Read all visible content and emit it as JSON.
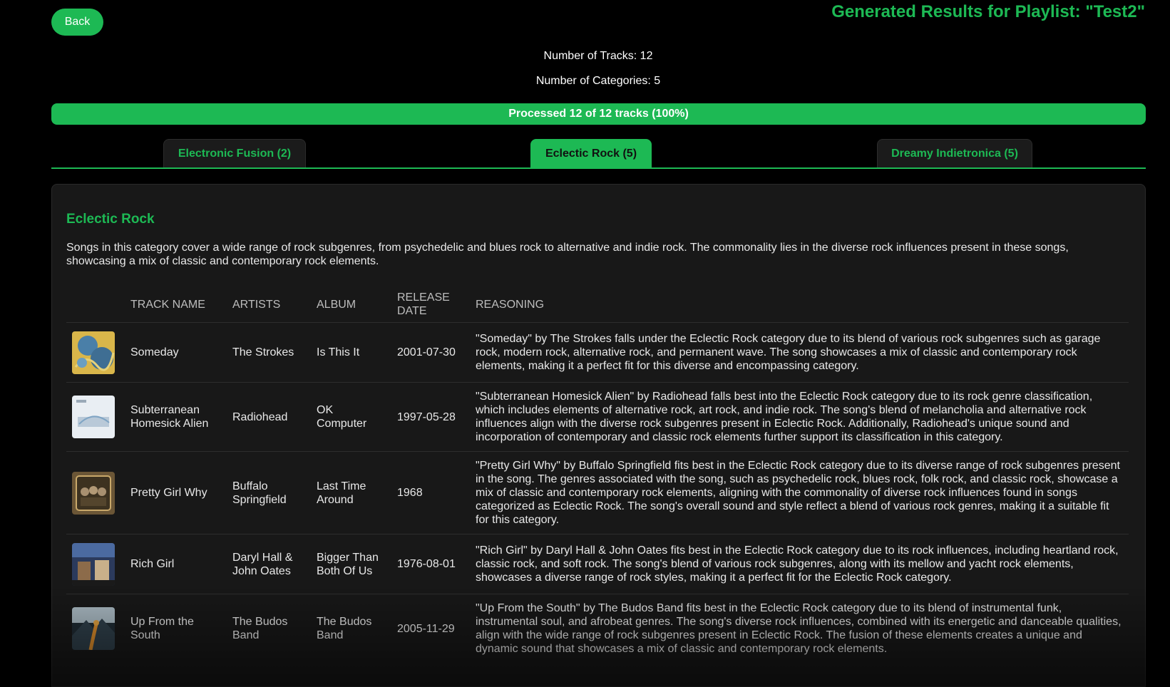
{
  "header": {
    "back_label": "Back",
    "title": "Generated Results for Playlist: \"Test2\""
  },
  "stats": {
    "tracks": "Number of Tracks: 12",
    "categories": "Number of Categories: 5"
  },
  "progress": {
    "label": "Processed 12 of 12 tracks (100%)",
    "fraction": 1.0,
    "color": "#1db954"
  },
  "tabs": [
    {
      "label": "Electronic Fusion (2)",
      "active": false
    },
    {
      "label": "Eclectic Rock (5)",
      "active": true
    },
    {
      "label": "Dreamy Indietronica (5)",
      "active": false
    }
  ],
  "category": {
    "title": "Eclectic Rock",
    "description": "Songs in this category cover a wide range of rock subgenres, from psychedelic and blues rock to alternative and indie rock. The commonality lies in the diverse rock influences present in these songs, showcasing a mix of classic and contemporary rock elements."
  },
  "table": {
    "headers": [
      "",
      "TRACK NAME",
      "ARTISTS",
      "ALBUM",
      "RELEASE DATE",
      "REASONING"
    ],
    "rows": [
      {
        "cover_icon": "album-cover-is-this-it",
        "track": "Someday",
        "artists": "The Strokes",
        "album": "Is This It",
        "release_date": "2001-07-30",
        "reasoning": "\"Someday\" by The Strokes falls under the Eclectic Rock category due to its blend of various rock subgenres such as garage rock, modern rock, alternative rock, and permanent wave. The song showcases a mix of classic and contemporary rock elements, making it a perfect fit for this diverse and encompassing category."
      },
      {
        "cover_icon": "album-cover-ok-computer",
        "track": "Subterranean Homesick Alien",
        "artists": "Radiohead",
        "album": "OK Computer",
        "release_date": "1997-05-28",
        "reasoning": "\"Subterranean Homesick Alien\" by Radiohead falls best into the Eclectic Rock category due to its rock genre classification, which includes elements of alternative rock, art rock, and indie rock. The song's blend of melancholia and alternative rock influences align with the diverse rock subgenres present in Eclectic Rock. Additionally, Radiohead's unique sound and incorporation of contemporary and classic rock elements further support its classification in this category."
      },
      {
        "cover_icon": "album-cover-last-time-around",
        "track": "Pretty Girl Why",
        "artists": "Buffalo Springfield",
        "album": "Last Time Around",
        "release_date": "1968",
        "reasoning": "\"Pretty Girl Why\" by Buffalo Springfield fits best in the Eclectic Rock category due to its diverse range of rock subgenres present in the song. The genres associated with the song, such as psychedelic rock, blues rock, folk rock, and classic rock, showcase a mix of classic and contemporary rock elements, aligning with the commonality of diverse rock influences found in songs categorized as Eclectic Rock. The song's overall sound and style reflect a blend of various rock genres, making it a suitable fit for this category."
      },
      {
        "cover_icon": "album-cover-bigger-than-both-of-us",
        "track": "Rich Girl",
        "artists": "Daryl Hall & John Oates",
        "album": "Bigger Than Both Of Us",
        "release_date": "1976-08-01",
        "reasoning": "\"Rich Girl\" by Daryl Hall & John Oates fits best in the Eclectic Rock category due to its rock influences, including heartland rock, classic rock, and soft rock. The song's blend of various rock subgenres, along with its mellow and yacht rock elements, showcases a diverse range of rock styles, making it a perfect fit for the Eclectic Rock category."
      },
      {
        "cover_icon": "album-cover-the-budos-band",
        "track": "Up From the South",
        "artists": "The Budos Band",
        "album": "The Budos Band",
        "release_date": "2005-11-29",
        "reasoning": "\"Up From the South\" by The Budos Band fits best in the Eclectic Rock category due to its blend of instrumental funk, instrumental soul, and afrobeat genres. The song's diverse rock influences, combined with its energetic and danceable qualities, align with the wide range of rock subgenres present in Eclectic Rock. The fusion of these elements creates a unique and dynamic sound that showcases a mix of classic and contemporary rock elements."
      }
    ]
  }
}
